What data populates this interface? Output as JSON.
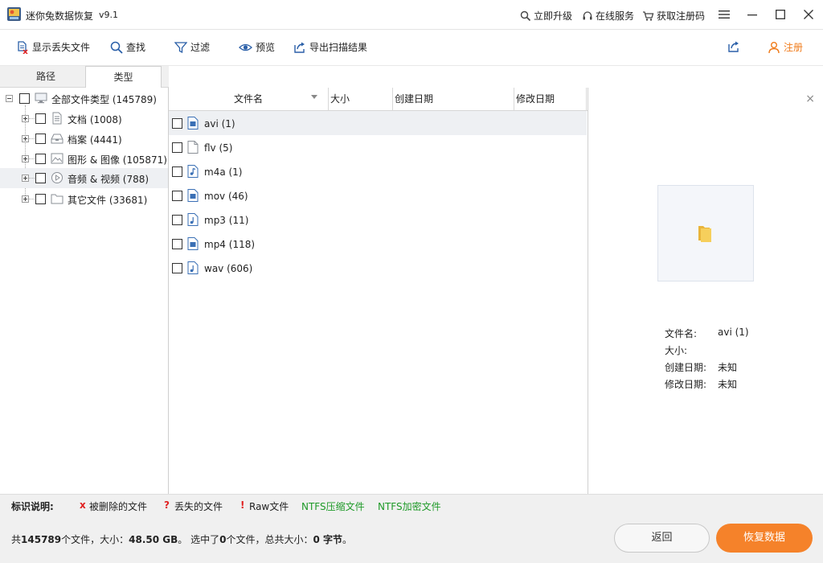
{
  "app": {
    "title": "迷你兔数据恢复",
    "version": "v9.1"
  },
  "titlebar": {
    "upgrade": "立即升级",
    "online_service": "在线服务",
    "get_code": "获取注册码"
  },
  "toolbar": {
    "show_lost": "显示丢失文件",
    "find": "查找",
    "filter": "过滤",
    "preview": "预览",
    "export": "导出扫描结果",
    "register": "注册"
  },
  "tabs": {
    "path": "路径",
    "type": "类型"
  },
  "tree": {
    "root": "全部文件类型 (145789)",
    "items": [
      {
        "label": "文档 (1008)",
        "icon": "document-icon"
      },
      {
        "label": "档案 (4441)",
        "icon": "archive-icon"
      },
      {
        "label": "图形 & 图像 (105871)",
        "icon": "image-icon"
      },
      {
        "label": "音频 & 视频 (788)",
        "icon": "media-icon"
      },
      {
        "label": "其它文件 (33681)",
        "icon": "folder-icon"
      }
    ]
  },
  "list": {
    "columns": [
      "文件名",
      "大小",
      "创建日期",
      "修改日期"
    ],
    "rows": [
      {
        "name": "avi (1)",
        "icon": "video-file-icon"
      },
      {
        "name": "flv (5)",
        "icon": "blank-file-icon"
      },
      {
        "name": "m4a (1)",
        "icon": "audio-file-icon"
      },
      {
        "name": "mov (46)",
        "icon": "video-file-icon"
      },
      {
        "name": "mp3 (11)",
        "icon": "music-file-icon"
      },
      {
        "name": "mp4 (118)",
        "icon": "video-file-icon"
      },
      {
        "name": "wav (606)",
        "icon": "music-file-icon"
      }
    ]
  },
  "preview": {
    "labels": {
      "name": "文件名:",
      "size": "大小:",
      "created": "创建日期:",
      "modified": "修改日期:"
    },
    "values": {
      "name": "avi (1)",
      "size": "",
      "created": "未知",
      "modified": "未知"
    }
  },
  "legend": {
    "title": "标识说明:",
    "deleted_mark": "x",
    "deleted": "被删除的文件",
    "lost_mark": "?",
    "lost": "丢失的文件",
    "raw_mark": "!",
    "raw": "Raw文件",
    "ntfs_compressed": "NTFS压缩文件",
    "ntfs_encrypted": "NTFS加密文件"
  },
  "status": {
    "prefix": "共",
    "total_count": "145789",
    "mid1": "个文件，大小：",
    "total_size": "48.50 GB",
    "mid2": "。 选中了",
    "selected_count": "0",
    "mid3": "个文件，总共大小：",
    "selected_size": "0 字节",
    "suffix": "。"
  },
  "buttons": {
    "back": "返回",
    "recover": "恢复数据"
  },
  "colors": {
    "accent": "#f5822a",
    "register": "#f07c1c",
    "deleted_mark": "#e02020",
    "ntfs_text": "#1e9a28",
    "toolbar_icon": "#2a5fa8"
  }
}
